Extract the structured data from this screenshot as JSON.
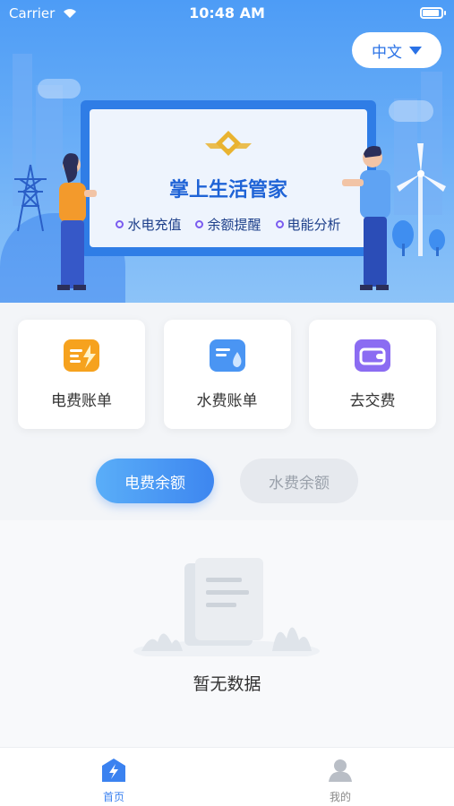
{
  "status_bar": {
    "carrier": "Carrier",
    "time": "10:48 AM"
  },
  "header": {
    "language": "中文"
  },
  "banner": {
    "title": "掌上生活管家",
    "features": [
      "水电充值",
      "余额提醒",
      "电能分析"
    ]
  },
  "cards": [
    {
      "label": "电费账单",
      "icon": "electric-bill-icon",
      "color": "#f6a21e"
    },
    {
      "label": "水费账单",
      "icon": "water-bill-icon",
      "color": "#4a95f3"
    },
    {
      "label": "去交费",
      "icon": "wallet-icon",
      "color": "#8b6cf2"
    }
  ],
  "balance_tabs": {
    "active": "电费余额",
    "inactive": "水费余额"
  },
  "empty_state": {
    "text": "暂无数据"
  },
  "tabbar": {
    "home": "首页",
    "mine": "我的"
  },
  "colors": {
    "primary": "#3b82f0",
    "hero": "#4d9cf6"
  }
}
